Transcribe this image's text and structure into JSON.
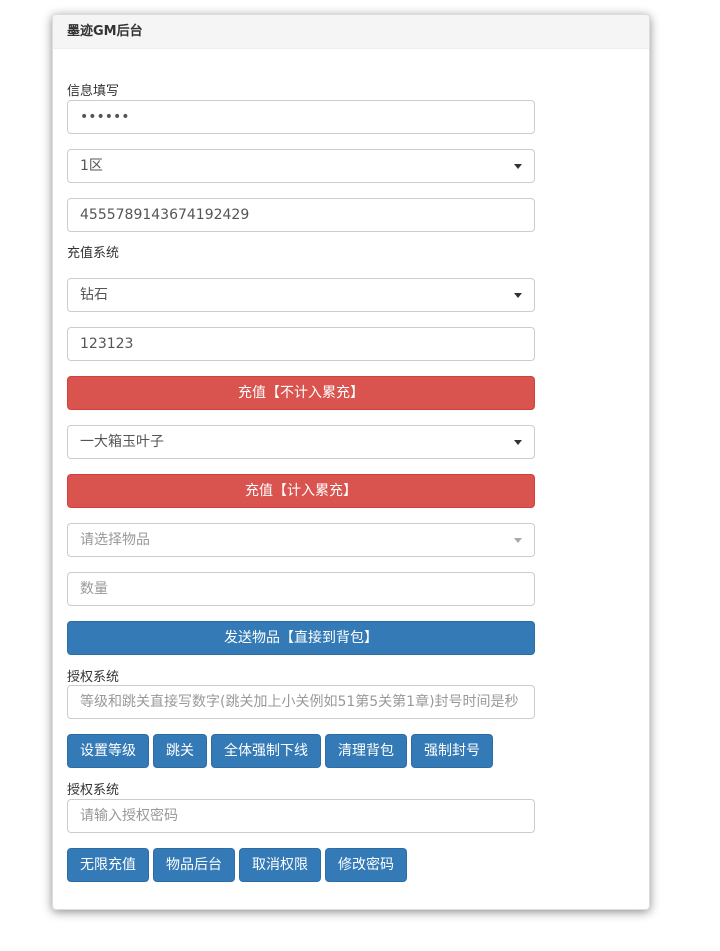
{
  "header": {
    "title": "墨迹GM后台"
  },
  "info_section": {
    "label": "信息填写",
    "password_value": "••••••",
    "server_select": "1区",
    "id_value": "4555789143674192429"
  },
  "recharge_section": {
    "label": "充值系统",
    "currency_select": "钻石",
    "amount_value": "123123",
    "recharge_no_accum_label": "充值【不计入累充】",
    "package_select": "一大箱玉叶子",
    "recharge_accum_label": "充值【计入累充】",
    "item_select_placeholder": "请选择物品",
    "quantity_placeholder": "数量",
    "send_item_label": "发送物品【直接到背包】"
  },
  "auth_section_1": {
    "label": "授权系统",
    "input_placeholder": "等级和跳关直接写数字(跳关加上小关例如51第5关第1章)封号时间是秒",
    "buttons": [
      "设置等级",
      "跳关",
      "全体强制下线",
      "清理背包",
      "强制封号"
    ]
  },
  "auth_section_2": {
    "label": "授权系统",
    "input_placeholder": "请输入授权密码",
    "buttons": [
      "无限充值",
      "物品后台",
      "取消权限",
      "修改密码"
    ]
  },
  "colors": {
    "danger": "#d9534f",
    "primary": "#337ab7",
    "panel_heading_bg": "#f5f5f5"
  }
}
